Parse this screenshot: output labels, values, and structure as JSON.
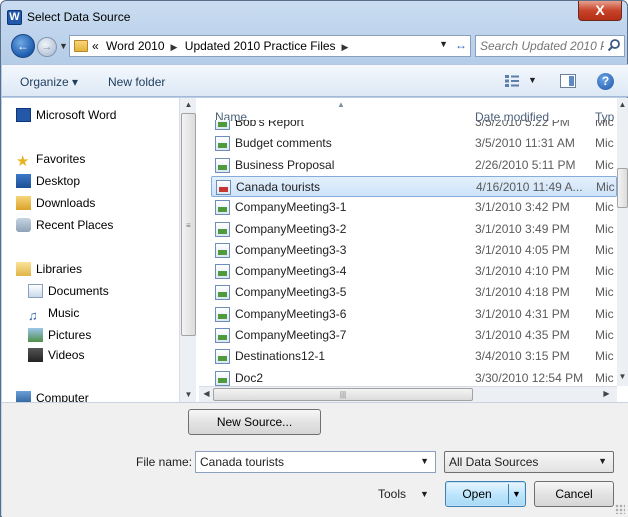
{
  "window": {
    "title": "Select Data Source",
    "app_icon_letter": "W",
    "close_glyph": "X"
  },
  "address": {
    "crumbs": [
      "«",
      "Word 2010",
      "Updated 2010 Practice Files"
    ],
    "search_placeholder": "Search Updated 2010 P..."
  },
  "toolbar": {
    "organize_label": "Organize ▾",
    "new_folder_label": "New folder"
  },
  "nav_pane": {
    "items": [
      {
        "label": "Microsoft Word",
        "icon": "word-icon"
      },
      {
        "label": "Favorites",
        "icon": "star-icon"
      },
      {
        "label": "Desktop",
        "icon": "desktop-icon"
      },
      {
        "label": "Downloads",
        "icon": "downloads-icon"
      },
      {
        "label": "Recent Places",
        "icon": "recent-places-icon"
      },
      {
        "label": "Libraries",
        "icon": "libraries-icon"
      },
      {
        "label": "Documents",
        "icon": "documents-icon"
      },
      {
        "label": "Music",
        "icon": "music-icon"
      },
      {
        "label": "Pictures",
        "icon": "pictures-icon"
      },
      {
        "label": "Videos",
        "icon": "videos-icon"
      },
      {
        "label": "Computer",
        "icon": "computer-icon"
      }
    ]
  },
  "file_list": {
    "columns": {
      "name": "Name",
      "date": "Date modified",
      "type": "Typ"
    },
    "rows": [
      {
        "name": "Bob's Report",
        "date": "3/5/2010 5:22 PM",
        "type": "Mic"
      },
      {
        "name": "Budget comments",
        "date": "3/5/2010 11:31 AM",
        "type": "Mic"
      },
      {
        "name": "Business Proposal",
        "date": "2/26/2010 5:11 PM",
        "type": "Mic"
      },
      {
        "name": "Canada tourists",
        "date": "4/16/2010 11:49 A...",
        "type": "Mic",
        "selected": true
      },
      {
        "name": "CompanyMeeting3-1",
        "date": "3/1/2010 3:42 PM",
        "type": "Mic"
      },
      {
        "name": "CompanyMeeting3-2",
        "date": "3/1/2010 3:49 PM",
        "type": "Mic"
      },
      {
        "name": "CompanyMeeting3-3",
        "date": "3/1/2010 4:05 PM",
        "type": "Mic"
      },
      {
        "name": "CompanyMeeting3-4",
        "date": "3/1/2010 4:10 PM",
        "type": "Mic"
      },
      {
        "name": "CompanyMeeting3-5",
        "date": "3/1/2010 4:18 PM",
        "type": "Mic"
      },
      {
        "name": "CompanyMeeting3-6",
        "date": "3/1/2010 4:31 PM",
        "type": "Mic"
      },
      {
        "name": "CompanyMeeting3-7",
        "date": "3/1/2010 4:35 PM",
        "type": "Mic"
      },
      {
        "name": "Destinations12-1",
        "date": "3/4/2010 3:15 PM",
        "type": "Mic"
      },
      {
        "name": "Doc2",
        "date": "3/30/2010 12:54 PM",
        "type": "Mic"
      }
    ]
  },
  "bottom": {
    "new_source_label": "New Source...",
    "file_name_label": "File name:",
    "file_name_value": "Canada tourists",
    "filter_value": "All Data Sources",
    "tools_label": "Tools",
    "open_label": "Open",
    "cancel_label": "Cancel"
  },
  "colors": {
    "selection_bg": "#cde3f9",
    "selection_border": "#84acdd",
    "close_red": "#c7432a",
    "accent_blue": "#1e5cae"
  }
}
